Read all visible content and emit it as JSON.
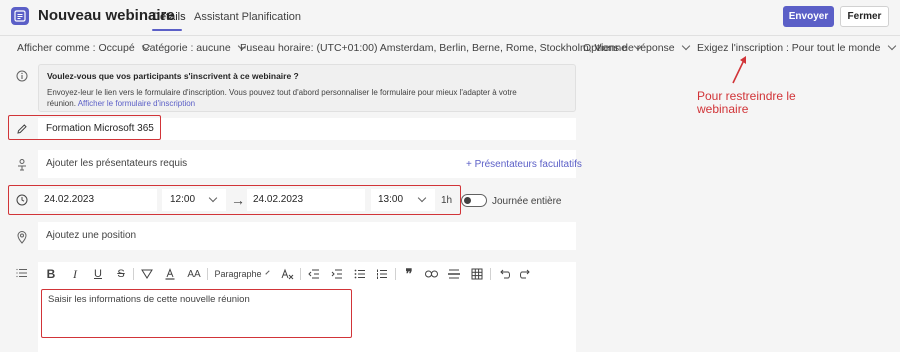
{
  "header": {
    "title": "Nouveau webinaire",
    "tabs": [
      {
        "label": "Détails",
        "active": true
      },
      {
        "label": "Assistant Planification",
        "active": false
      }
    ],
    "send_label": "Envoyer",
    "close_label": "Fermer"
  },
  "options": {
    "show_as": "Afficher comme : Occupé",
    "category": "Catégorie : aucune",
    "timezone": "Fuseau horaire: (UTC+01:00) Amsterdam, Berlin, Berne, Rome, Stockholm, Vienne",
    "reply_options": "Options de réponse",
    "registration": "Exigez l'inscription : Pour tout le monde"
  },
  "info": {
    "title": "Voulez-vous que vos participants s'inscrivent à ce webinaire ?",
    "text": "Envoyez-leur le lien vers le formulaire d'inscription. Vous pouvez tout d'abord personnaliser le formulaire pour mieux l'adapter à votre réunion.",
    "link": "Afficher le formulaire d'inscription"
  },
  "form": {
    "title_value": "Formation Microsoft 365",
    "presenters_placeholder": "Ajouter les présentateurs requis",
    "optional_presenters": "+ Présentateurs facultatifs",
    "start_date": "24.02.2023",
    "start_time": "12:00",
    "end_date": "24.02.2023",
    "end_time": "13:00",
    "duration": "1h",
    "all_day_label": "Journée entière",
    "all_day": false,
    "location_placeholder": "Ajoutez une position",
    "paragraph_style": "Paragraphe",
    "description_placeholder": "Saisir les informations de cette nouvelle réunion"
  },
  "annotation": {
    "text": "Pour restreindre le webinaire",
    "color": "#d13438"
  },
  "colors": {
    "accent": "#5b5fc7",
    "highlight": "#d13438"
  }
}
